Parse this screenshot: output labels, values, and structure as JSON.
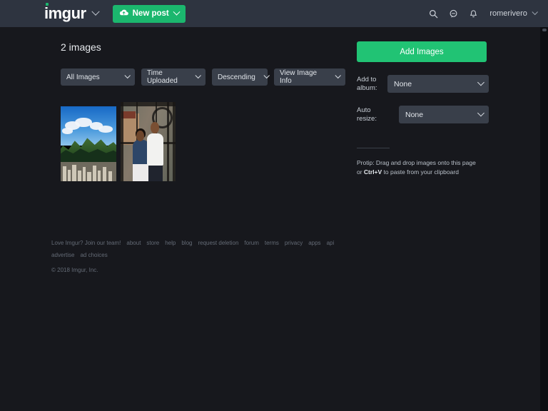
{
  "topbar": {
    "logo_text": "imgur",
    "logo_dropdown_icon": "chevron-down-icon",
    "new_post_label": "New post",
    "new_post_icon": "cloud-upload-icon",
    "new_post_dropdown_icon": "chevron-down-icon",
    "icons": [
      {
        "name": "search-icon",
        "glyph": "search"
      },
      {
        "name": "chat-icon",
        "glyph": "chat"
      },
      {
        "name": "notifications-bell-icon",
        "glyph": "bell"
      }
    ],
    "username": "romerivero",
    "username_dropdown_icon": "chevron-down-icon",
    "colors": {
      "bar_bg": "#2e3440",
      "accent_green": "#1bb76e"
    }
  },
  "main": {
    "title": "2 images",
    "filters": [
      {
        "name": "image-type-filter",
        "value": "All Images"
      },
      {
        "name": "sort-field-filter",
        "value": "Time Uploaded"
      },
      {
        "name": "sort-direction-filter",
        "value": "Descending"
      },
      {
        "name": "view-mode-filter",
        "value": "View Image Info"
      }
    ],
    "thumbnails": [
      {
        "name": "thumbnail-mountain-city",
        "alt": "Green mountain range above a city"
      },
      {
        "name": "thumbnail-couple",
        "alt": "Couple posing in front of an ironwork structure"
      }
    ]
  },
  "sidebar": {
    "add_images_label": "Add Images",
    "add_to_album_label": "Add to album:",
    "add_to_album_value": "None",
    "auto_resize_label": "Auto resize:",
    "auto_resize_value": "None",
    "protip_prefix": "Protip: Drag and drop images onto this page or ",
    "protip_shortcut": "Ctrl+V",
    "protip_suffix": " to paste from your clipboard",
    "colors": {
      "button_green": "#21c374",
      "select_bg": "#393f4a"
    }
  },
  "footer": {
    "links": [
      "Love Imgur? Join our team!",
      "about",
      "store",
      "help",
      "blog",
      "request deletion",
      "forum",
      "terms",
      "privacy",
      "apps",
      "api",
      "advertise",
      "ad choices"
    ],
    "copyright": "© 2018 Imgur, Inc."
  }
}
